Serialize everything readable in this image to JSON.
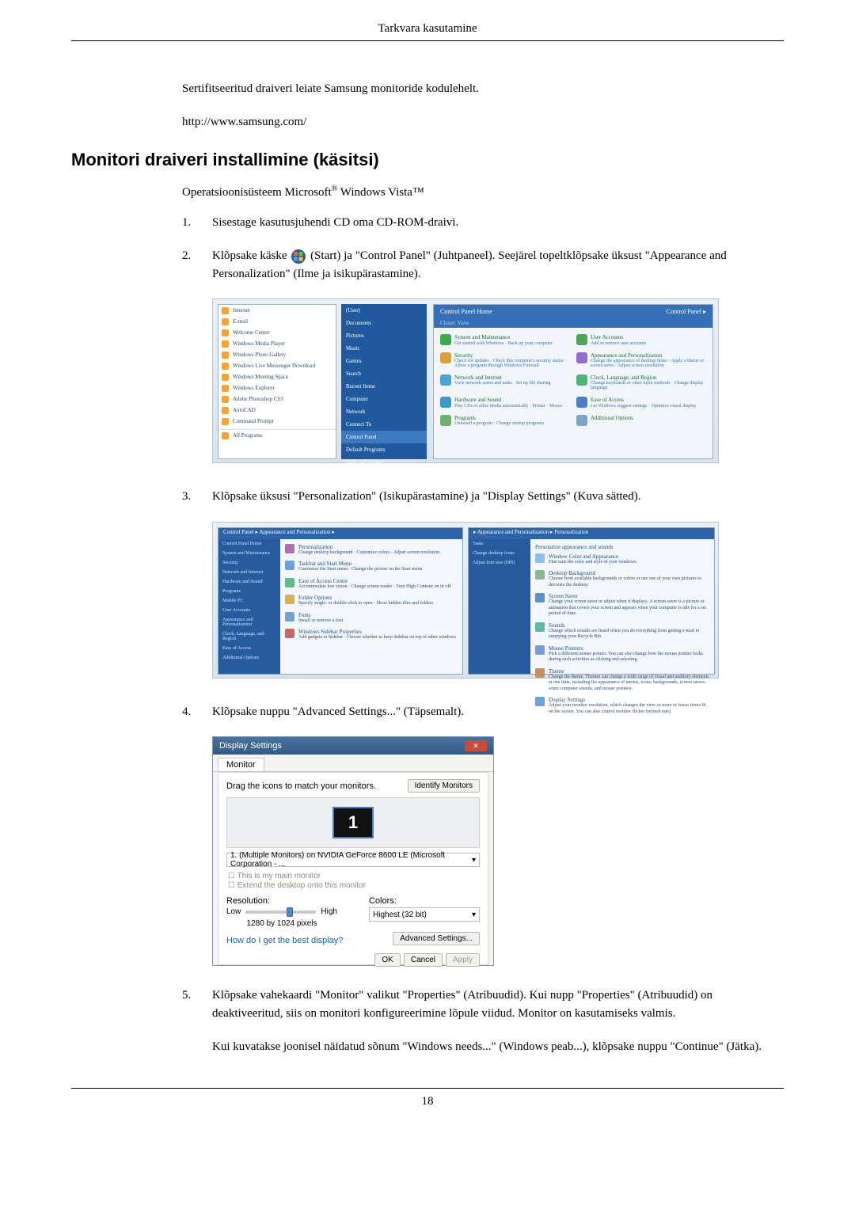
{
  "header": {
    "chapter": "Tarkvara kasutamine"
  },
  "intro": {
    "line1": "Sertifitseeritud draiveri leiate Samsung monitoride kodulehelt.",
    "url": "http://www.samsung.com/"
  },
  "section_title": "Monitori draiveri installimine (käsitsi)",
  "os_line_prefix": "Operatsioonisüsteem Microsoft",
  "os_line_suffix": " Windows Vista™",
  "steps": {
    "s1": {
      "n": "1.",
      "t": "Sisestage kasutusjuhendi CD oma CD-ROM-draivi."
    },
    "s2": {
      "n": "2.",
      "t1": "Klõpsake käske ",
      "t2": "(Start) ja \"Control Panel\" (Juhtpaneel). Seejärel topeltklõpsake üksust \"Appearance and Personalization\" (Ilme ja isikupärastamine)."
    },
    "s3": {
      "n": "3.",
      "t": "Klõpsake üksusi \"Personalization\" (Isikupärastamine) ja \"Display Settings\" (Kuva sätted)."
    },
    "s4": {
      "n": "4.",
      "t": "Klõpsake nuppu \"Advanced Settings...\" (Täpsemalt)."
    },
    "s5": {
      "n": "5.",
      "t": "Klõpsake vahekaardi \"Monitor\" valikut \"Properties\" (Atribuudid). Kui nupp \"Properties\" (Atribuudid) on deaktiveeritud, siis on monitori konfigureerimine lõpule viidud. Monitor on kasutamiseks valmis."
    },
    "s5b": "Kui kuvatakse joonisel näidatud sõnum \"Windows needs...\" (Windows peab...), klõpsake nuppu \"Continue\" (Jätka)."
  },
  "fig1": {
    "left_items": [
      "Internet",
      "E-mail",
      "Welcome Center",
      "Windows Media Player",
      "Windows Photo Gallery",
      "Windows Live Messenger Download",
      "Windows Meeting Space",
      "Windows Explorer",
      "Adobe Photoshop CS3",
      "AutoCAD",
      "Command Prompt"
    ],
    "all_programs": "All Programs",
    "mid_items": [
      "(User)",
      "Documents",
      "Pictures",
      "Music",
      "Games",
      "Search",
      "Recent Items",
      "Computer",
      "Network",
      "Connect To",
      "Control Panel",
      "Default Programs",
      "Help and Support"
    ],
    "cp_crumb": "Control Panel ▸",
    "cp_head_left": "Control Panel Home",
    "cp_head_left2": "Classic View",
    "items": [
      {
        "t": "System and Maintenance",
        "s": "Get started with Windows · Back up your computer",
        "c": "#3faa4c"
      },
      {
        "t": "User Accounts",
        "s": "Add or remove user accounts",
        "c": "#4ea554"
      },
      {
        "t": "Security",
        "s": "Check for updates · Check this computer's security status · Allow a program through Windows Firewall",
        "c": "#d7a33a"
      },
      {
        "t": "Appearance and Personalization",
        "s": "Change the appearance of desktop items · Apply a theme or screen saver · Adjust screen resolution",
        "c": "#8f6fd0"
      },
      {
        "t": "Network and Internet",
        "s": "View network status and tasks · Set up file sharing",
        "c": "#4aa3d6"
      },
      {
        "t": "Clock, Language, and Region",
        "s": "Change keyboards or other input methods · Change display language",
        "c": "#51b27a"
      },
      {
        "t": "Hardware and Sound",
        "s": "Play CDs or other media automatically · Printer · Mouse",
        "c": "#3f9acb"
      },
      {
        "t": "Ease of Access",
        "s": "Let Windows suggest settings · Optimize visual display",
        "c": "#4c7fc4"
      },
      {
        "t": "Programs",
        "s": "Uninstall a program · Change startup programs",
        "c": "#6eb06e"
      },
      {
        "t": "Additional Options",
        "s": "",
        "c": "#7ea4c8"
      }
    ]
  },
  "fig2": {
    "left_crumb": "Control Panel ▸ Appearance and Personalization ▸",
    "right_crumb": "▸ Appearance and Personalization ▸ Personalization",
    "left_side": [
      "Control Panel Home",
      "System and Maintenance",
      "Security",
      "Network and Internet",
      "Hardware and Sound",
      "Programs",
      "Mobile PC",
      "User Accounts",
      "Appearance and Personalization",
      "Clock, Language, and Region",
      "Ease of Access",
      "Additional Options"
    ],
    "left_main": [
      {
        "h": "Personalization",
        "s": "Change desktop background · Customize colors · Adjust screen resolution",
        "c": "#b06fae"
      },
      {
        "h": "Taskbar and Start Menu",
        "s": "Customize the Start menu · Change the picture on the Start menu",
        "c": "#6aa4d6"
      },
      {
        "h": "Ease of Access Center",
        "s": "Accommodate low vision · Change screen reader · Turn High Contrast on or off",
        "c": "#5fbf87"
      },
      {
        "h": "Folder Options",
        "s": "Specify single- or double-click to open · Show hidden files and folders",
        "c": "#d6b25c"
      },
      {
        "h": "Fonts",
        "s": "Install or remove a font",
        "c": "#7aa2c9"
      },
      {
        "h": "Windows Sidebar Properties",
        "s": "Add gadgets to Sidebar · Choose whether to keep Sidebar on top of other windows",
        "c": "#c46a6a"
      }
    ],
    "right_side": [
      "Tasks",
      "Change desktop icons",
      "Adjust font size (DPI)"
    ],
    "right_title": "Personalize appearance and sounds",
    "right_main": [
      {
        "h": "Window Color and Appearance",
        "s": "Fine tune the color and style of your windows.",
        "c": "#8fc0e6"
      },
      {
        "h": "Desktop Background",
        "s": "Choose from available backgrounds or colors or use one of your own pictures to decorate the desktop.",
        "c": "#8db88f"
      },
      {
        "h": "Screen Saver",
        "s": "Change your screen saver or adjust when it displays. A screen saver is a picture or animation that covers your screen and appears when your computer is idle for a set period of time.",
        "c": "#5c90c4"
      },
      {
        "h": "Sounds",
        "s": "Change which sounds are heard when you do everything from getting e-mail to emptying your Recycle Bin.",
        "c": "#5fb6a4"
      },
      {
        "h": "Mouse Pointers",
        "s": "Pick a different mouse pointer. You can also change how the mouse pointer looks during such activities as clicking and selecting.",
        "c": "#7a9cd0"
      },
      {
        "h": "Theme",
        "s": "Change the theme. Themes can change a wide range of visual and auditory elements at one time, including the appearance of menus, icons, backgrounds, screen savers, some computer sounds, and mouse pointers.",
        "c": "#c98f5f"
      },
      {
        "h": "Display Settings",
        "s": "Adjust your monitor resolution, which changes the view so more or fewer items fit on the screen. You can also control monitor flicker (refresh rate).",
        "c": "#6aa4d6"
      }
    ]
  },
  "fig3": {
    "title": "Display Settings",
    "tab": "Monitor",
    "drag_label": "Drag the icons to match your monitors.",
    "identify": "Identify Monitors",
    "mon_num": "1",
    "selector": "1. (Multiple Monitors) on NVIDIA GeForce 8600 LE (Microsoft Corporation - ...",
    "chk1": "This is my main monitor",
    "chk2": "Extend the desktop onto this monitor",
    "resolution_label": "Resolution:",
    "low": "Low",
    "high": "High",
    "reso_value": "1280 by 1024 pixels",
    "colors_label": "Colors:",
    "colors_value": "Highest (32 bit)",
    "help_link": "How do I get the best display?",
    "advanced": "Advanced Settings...",
    "ok": "OK",
    "cancel": "Cancel",
    "apply": "Apply"
  },
  "footer": {
    "page": "18"
  }
}
